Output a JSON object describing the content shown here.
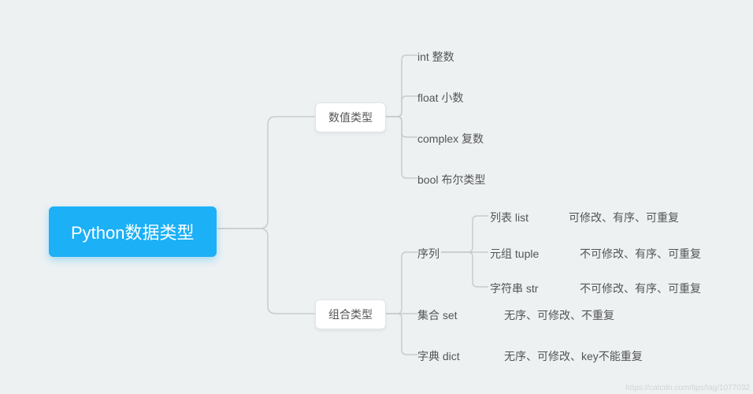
{
  "root": {
    "label": "Python数据类型"
  },
  "cat_numeric": {
    "label": "数值类型"
  },
  "cat_composite": {
    "label": "组合类型"
  },
  "num_int": "int 整数",
  "num_float": "float 小数",
  "num_complex": "complex 复数",
  "num_bool": "bool 布尔类型",
  "comp_seq": "序列",
  "comp_set": "集合 set",
  "comp_set_attr": "无序、可修改、不重复",
  "comp_dict": "字典 dict",
  "comp_dict_attr": "无序、可修改、key不能重复",
  "seq_list": "列表 list",
  "seq_list_attr": "可修改、有序、可重复",
  "seq_tuple": "元组 tuple",
  "seq_tuple_attr": "不可修改、有序、可重复",
  "seq_str": "字符串 str",
  "seq_str_attr": "不可修改、有序、可重复",
  "watermark": "https://catcdn.com/tips/tag/1077032"
}
